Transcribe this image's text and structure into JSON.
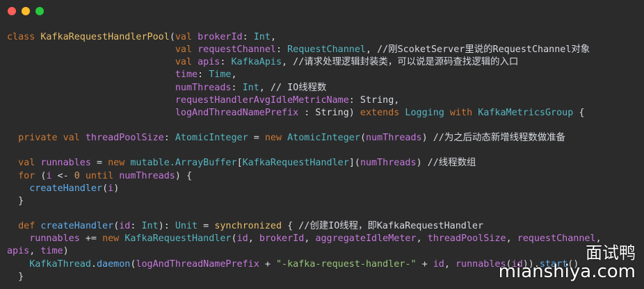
{
  "window": {
    "controls": [
      "close",
      "minimize",
      "maximize"
    ]
  },
  "code": {
    "lines": [
      [
        {
          "t": "class ",
          "c": "k1"
        },
        {
          "t": "KafkaRequestHandlerPool",
          "c": "y1"
        },
        {
          "t": "(",
          "c": "w1"
        },
        {
          "t": "val ",
          "c": "k1"
        },
        {
          "t": "brokerId",
          "c": "p1"
        },
        {
          "t": ": ",
          "c": "w1"
        },
        {
          "t": "Int",
          "c": "t1"
        },
        {
          "t": ",",
          "c": "w1"
        }
      ],
      [
        {
          "t": "                              ",
          "c": "w1"
        },
        {
          "t": "val ",
          "c": "k1"
        },
        {
          "t": "requestChannel",
          "c": "p1"
        },
        {
          "t": ": ",
          "c": "w1"
        },
        {
          "t": "RequestChannel",
          "c": "t1"
        },
        {
          "t": ", //刚ScoketServer里说的RequestChannel对象",
          "c": "w1"
        }
      ],
      [
        {
          "t": "                              ",
          "c": "w1"
        },
        {
          "t": "val ",
          "c": "k1"
        },
        {
          "t": "apis",
          "c": "p1"
        },
        {
          "t": ": ",
          "c": "w1"
        },
        {
          "t": "KafkaApis",
          "c": "t1"
        },
        {
          "t": ", //请求处理逻辑封装类，可以说是源码查找逻辑的入口",
          "c": "w1"
        }
      ],
      [
        {
          "t": "                              ",
          "c": "w1"
        },
        {
          "t": "time",
          "c": "p1"
        },
        {
          "t": ": ",
          "c": "w1"
        },
        {
          "t": "Time",
          "c": "t1"
        },
        {
          "t": ",",
          "c": "w1"
        }
      ],
      [
        {
          "t": "                              ",
          "c": "w1"
        },
        {
          "t": "numThreads",
          "c": "p1"
        },
        {
          "t": ": ",
          "c": "w1"
        },
        {
          "t": "Int",
          "c": "t1"
        },
        {
          "t": ", // IO线程数",
          "c": "w1"
        }
      ],
      [
        {
          "t": "                              ",
          "c": "w1"
        },
        {
          "t": "requestHandlerAvgIdleMetricName",
          "c": "p1"
        },
        {
          "t": ": String,",
          "c": "w1"
        }
      ],
      [
        {
          "t": "                              ",
          "c": "w1"
        },
        {
          "t": "logAndThreadNamePrefix",
          "c": "p1"
        },
        {
          "t": " : String) ",
          "c": "w1"
        },
        {
          "t": "extends ",
          "c": "k1"
        },
        {
          "t": "Logging ",
          "c": "t1"
        },
        {
          "t": "with ",
          "c": "k1"
        },
        {
          "t": "KafkaMetricsGroup",
          "c": "t1"
        },
        {
          "t": " {",
          "c": "w1"
        }
      ],
      [
        {
          "t": "",
          "c": "w1"
        }
      ],
      [
        {
          "t": "  ",
          "c": "w1"
        },
        {
          "t": "private val ",
          "c": "k1"
        },
        {
          "t": "threadPoolSize",
          "c": "p1"
        },
        {
          "t": ": ",
          "c": "w1"
        },
        {
          "t": "AtomicInteger",
          "c": "t1"
        },
        {
          "t": " = ",
          "c": "w1"
        },
        {
          "t": "new ",
          "c": "k1"
        },
        {
          "t": "AtomicInteger",
          "c": "t1"
        },
        {
          "t": "(",
          "c": "w1"
        },
        {
          "t": "numThreads",
          "c": "p1"
        },
        {
          "t": ") //为之后动态新增线程数做准备",
          "c": "w1"
        }
      ],
      [
        {
          "t": "",
          "c": "w1"
        }
      ],
      [
        {
          "t": "  ",
          "c": "w1"
        },
        {
          "t": "val ",
          "c": "k1"
        },
        {
          "t": "runnables",
          "c": "p1"
        },
        {
          "t": " = ",
          "c": "w1"
        },
        {
          "t": "new ",
          "c": "k1"
        },
        {
          "t": "mutable.ArrayBuffer",
          "c": "t1"
        },
        {
          "t": "[",
          "c": "w1"
        },
        {
          "t": "KafkaRequestHandler",
          "c": "t1"
        },
        {
          "t": "](",
          "c": "w1"
        },
        {
          "t": "numThreads",
          "c": "p1"
        },
        {
          "t": ") //线程数组",
          "c": "w1"
        }
      ],
      [
        {
          "t": "  ",
          "c": "w1"
        },
        {
          "t": "for ",
          "c": "k1"
        },
        {
          "t": "(",
          "c": "w1"
        },
        {
          "t": "i",
          "c": "p1"
        },
        {
          "t": " <- ",
          "c": "w1"
        },
        {
          "t": "0 ",
          "c": "o1"
        },
        {
          "t": "until ",
          "c": "k1"
        },
        {
          "t": "numThreads",
          "c": "p1"
        },
        {
          "t": ") {",
          "c": "w1"
        }
      ],
      [
        {
          "t": "    ",
          "c": "w1"
        },
        {
          "t": "createHandler",
          "c": "b1"
        },
        {
          "t": "(",
          "c": "w1"
        },
        {
          "t": "i",
          "c": "p1"
        },
        {
          "t": ")",
          "c": "w1"
        }
      ],
      [
        {
          "t": "  }",
          "c": "w1"
        }
      ],
      [
        {
          "t": "",
          "c": "w1"
        }
      ],
      [
        {
          "t": "  ",
          "c": "w1"
        },
        {
          "t": "def ",
          "c": "k1"
        },
        {
          "t": "createHandler",
          "c": "b1"
        },
        {
          "t": "(",
          "c": "w1"
        },
        {
          "t": "id",
          "c": "p1"
        },
        {
          "t": ": ",
          "c": "w1"
        },
        {
          "t": "Int",
          "c": "t1"
        },
        {
          "t": "): ",
          "c": "w1"
        },
        {
          "t": "Unit",
          "c": "t1"
        },
        {
          "t": " = ",
          "c": "w1"
        },
        {
          "t": "synchronized",
          "c": "y1"
        },
        {
          "t": " { //创建IO线程，即KafkaRequestHandler",
          "c": "w1"
        }
      ],
      [
        {
          "t": "    ",
          "c": "w1"
        },
        {
          "t": "runnables",
          "c": "p1"
        },
        {
          "t": " += ",
          "c": "w1"
        },
        {
          "t": "new ",
          "c": "k1"
        },
        {
          "t": "KafkaRequestHandler",
          "c": "t1"
        },
        {
          "t": "(",
          "c": "w1"
        },
        {
          "t": "id",
          "c": "p1"
        },
        {
          "t": ", ",
          "c": "w1"
        },
        {
          "t": "brokerId",
          "c": "p1"
        },
        {
          "t": ", ",
          "c": "w1"
        },
        {
          "t": "aggregateIdleMeter",
          "c": "p1"
        },
        {
          "t": ", ",
          "c": "w1"
        },
        {
          "t": "threadPoolSize",
          "c": "p1"
        },
        {
          "t": ", ",
          "c": "w1"
        },
        {
          "t": "requestChannel",
          "c": "p1"
        },
        {
          "t": ",",
          "c": "w1"
        }
      ],
      [
        {
          "t": "apis",
          "c": "p1"
        },
        {
          "t": ", ",
          "c": "w1"
        },
        {
          "t": "time",
          "c": "p1"
        },
        {
          "t": ")",
          "c": "w1"
        }
      ],
      [
        {
          "t": "    ",
          "c": "w1"
        },
        {
          "t": "KafkaThread",
          "c": "t1"
        },
        {
          "t": ".",
          "c": "w1"
        },
        {
          "t": "daemon",
          "c": "b1"
        },
        {
          "t": "(",
          "c": "w1"
        },
        {
          "t": "logAndThreadNamePrefix",
          "c": "p1"
        },
        {
          "t": " + ",
          "c": "w1"
        },
        {
          "t": "\"-kafka-request-handler-\"",
          "c": "g1"
        },
        {
          "t": " + ",
          "c": "w1"
        },
        {
          "t": "id",
          "c": "p1"
        },
        {
          "t": ", ",
          "c": "w1"
        },
        {
          "t": "runnables",
          "c": "p1"
        },
        {
          "t": "(",
          "c": "w1"
        },
        {
          "t": "id",
          "c": "p1"
        },
        {
          "t": ")).",
          "c": "w1"
        },
        {
          "t": "start",
          "c": "b1"
        },
        {
          "t": "()",
          "c": "w1"
        }
      ],
      [
        {
          "t": "  }",
          "c": "w1"
        }
      ]
    ]
  },
  "watermark": {
    "line1": "面试鸭",
    "line2": "mianshiya.com"
  }
}
